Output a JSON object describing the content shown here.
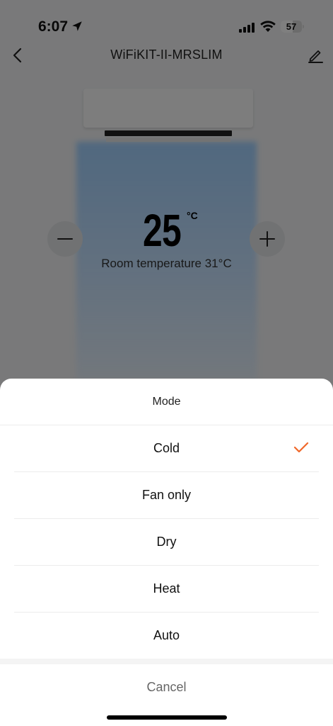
{
  "status_bar": {
    "time": "6:07",
    "battery": "57",
    "battery_level": 0.57,
    "icons": [
      "location-arrow-icon",
      "cellular-signal-icon",
      "wifi-icon",
      "battery-icon"
    ]
  },
  "nav": {
    "title": "WiFiKIT-II-MRSLIM",
    "back_icon": "chevron-left-icon",
    "edit_icon": "pencil-icon"
  },
  "thermostat": {
    "set_temp": "25",
    "unit": "°C",
    "room_temp": "Room temperature 31°C",
    "minus_icon": "minus-icon",
    "plus_icon": "plus-icon"
  },
  "mode_sheet": {
    "title": "Mode",
    "options": [
      {
        "label": "Cold",
        "selected": true
      },
      {
        "label": "Fan only",
        "selected": false
      },
      {
        "label": "Dry",
        "selected": false
      },
      {
        "label": "Heat",
        "selected": false
      },
      {
        "label": "Auto",
        "selected": false
      }
    ],
    "cancel_label": "Cancel",
    "check_icon": "checkmark-icon"
  },
  "colors": {
    "accent": "#F0682A",
    "airflow": "#9CCEFF",
    "overlay": "rgba(0,0,0,0.5)"
  }
}
